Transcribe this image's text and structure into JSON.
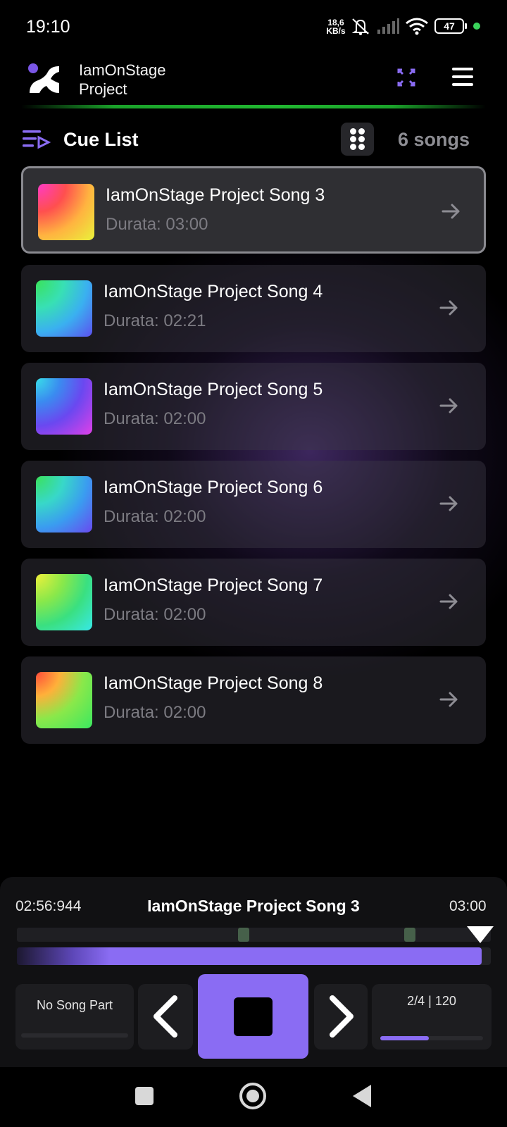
{
  "status_bar": {
    "time": "19:10",
    "net_speed_value": "18,6",
    "net_speed_unit": "KB/s",
    "battery": "47",
    "icons": [
      "mute-icon",
      "signal-icon",
      "wifi-icon",
      "battery-icon"
    ]
  },
  "header": {
    "app_title_line1": "IamOnStage",
    "app_title_line2": "Project",
    "icons": [
      "app-logo",
      "expand-icon",
      "menu-icon"
    ],
    "divider_color": "#21b831"
  },
  "cue_list": {
    "title": "Cue List",
    "count_label": "6 songs",
    "songs": [
      {
        "name": "IamOnStage Project Song 3",
        "duration": "Durata: 03:00",
        "active": true
      },
      {
        "name": "IamOnStage Project Song 4",
        "duration": "Durata: 02:21",
        "active": false
      },
      {
        "name": "IamOnStage Project Song 5",
        "duration": "Durata: 02:00",
        "active": false
      },
      {
        "name": "IamOnStage Project Song 6",
        "duration": "Durata: 02:00",
        "active": false
      },
      {
        "name": "IamOnStage Project Song 7",
        "duration": "Durata: 02:00",
        "active": false
      },
      {
        "name": "IamOnStage Project Song 8",
        "duration": "Durata: 02:00",
        "active": false
      }
    ]
  },
  "player": {
    "elapsed": "02:56:944",
    "song_title": "IamOnStage Project Song 3",
    "total": "03:00",
    "progress": 0.98,
    "song_part": "No Song Part",
    "tempo": "2/4 | 120",
    "tempo_level": 0.47,
    "accent_color": "#8a6cf3"
  },
  "navbar": {
    "icons": [
      "recent-apps-icon",
      "home-icon",
      "back-icon"
    ]
  }
}
